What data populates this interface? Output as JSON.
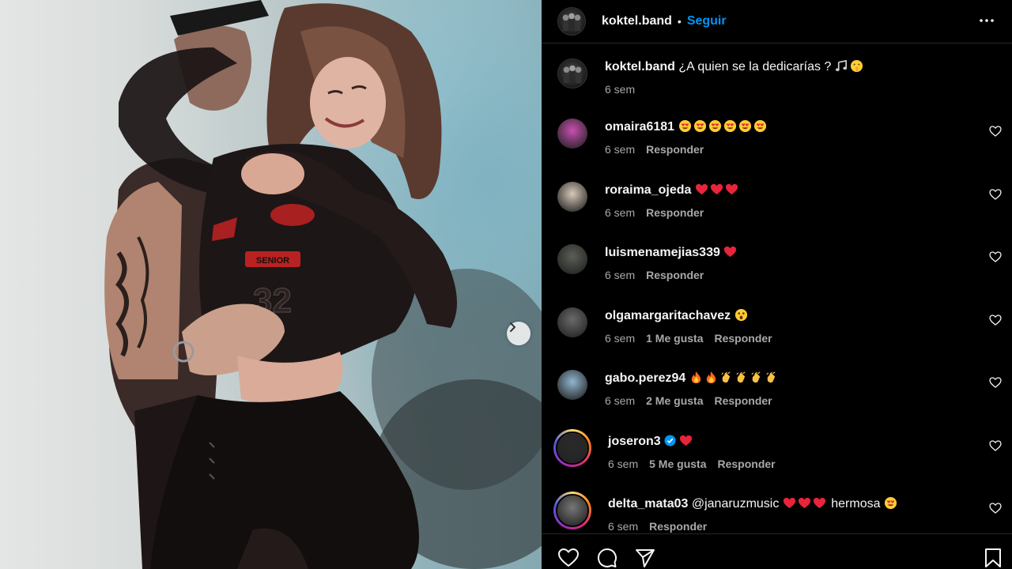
{
  "post": {
    "image_alt": "Singer with long hair in black racing bodysuit dancing with tattooed man on stage",
    "carousel_next_icon": "chevron-right-icon"
  },
  "header": {
    "username": "koktel.band",
    "separator": "•",
    "follow_label": "Seguir",
    "more_icon": "more-horizontal-icon"
  },
  "caption": {
    "username": "koktel.band",
    "text": "¿A quien se la dedicarías ?",
    "time": "6 sem"
  },
  "comments": [
    {
      "username": "omaira6181",
      "text": "",
      "emojis": [
        "heart-eyes",
        "heart-eyes",
        "heart-eyes",
        "heart-eyes",
        "heart-eyes",
        "heart-eyes"
      ],
      "time": "6 sem",
      "likes": "",
      "reply": "Responder",
      "avatar_color": "#c94fb0"
    },
    {
      "username": "roraima_ojeda",
      "text": "",
      "emojis": [
        "red-heart",
        "red-heart",
        "red-heart"
      ],
      "time": "6 sem",
      "likes": "",
      "reply": "Responder",
      "avatar_color": "#d8c9b8"
    },
    {
      "username": "luismenamejias339",
      "text": "",
      "emojis": [
        "red-heart"
      ],
      "time": "6 sem",
      "likes": "",
      "reply": "Responder",
      "avatar_color": "#5a5f55"
    },
    {
      "username": "olgamargaritachavez",
      "text": "",
      "emojis": [
        "astonished"
      ],
      "time": "6 sem",
      "likes": "1 Me gusta",
      "reply": "Responder",
      "avatar_color": "#6a6a6a"
    },
    {
      "username": "gabo.perez94",
      "text": "",
      "emojis": [
        "fire",
        "fire",
        "clap",
        "clap",
        "clap",
        "clap"
      ],
      "time": "6 sem",
      "likes": "2 Me gusta",
      "reply": "Responder",
      "avatar_color": "#8fb7d0"
    },
    {
      "username": "joseron3",
      "text": "",
      "emojis": [
        "red-heart"
      ],
      "verified": true,
      "time": "6 sem",
      "likes": "5 Me gusta",
      "reply": "Responder",
      "avatar_color": "#2b2b2b"
    },
    {
      "username": "delta_mata03",
      "text": "@janaruzmusic",
      "text_after": "hermosa",
      "emojis": [
        "red-heart",
        "red-heart",
        "red-heart"
      ],
      "emojis_after": [
        "heart-eyes"
      ],
      "time": "6 sem",
      "likes": "",
      "reply": "Responder",
      "avatar_color": "#777777"
    }
  ],
  "actions": {
    "like_icon": "heart-icon",
    "comment_icon": "comment-bubble-icon",
    "share_icon": "paper-plane-icon",
    "save_icon": "bookmark-icon"
  },
  "colors": {
    "background": "#000000",
    "text": "#f5f5f5",
    "secondary_text": "#a8a8a8",
    "accent_link": "#0095f6",
    "divider": "#262626"
  }
}
